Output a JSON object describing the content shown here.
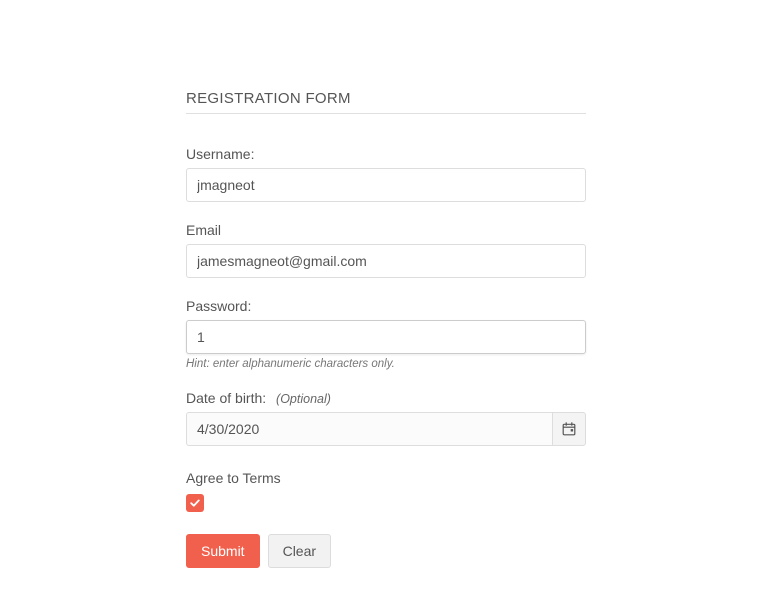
{
  "form": {
    "title": "REGISTRATION FORM",
    "username": {
      "label": "Username:",
      "value": "jmagneot"
    },
    "email": {
      "label": "Email",
      "value": "jamesmagneot@gmail.com"
    },
    "password": {
      "label": "Password:",
      "value": "1",
      "hint": "Hint: enter alphanumeric characters only."
    },
    "dob": {
      "label": "Date of birth:",
      "optional": "(Optional)",
      "value": "4/30/2020"
    },
    "terms": {
      "label": "Agree to Terms",
      "checked": true
    },
    "buttons": {
      "submit": "Submit",
      "clear": "Clear"
    }
  }
}
